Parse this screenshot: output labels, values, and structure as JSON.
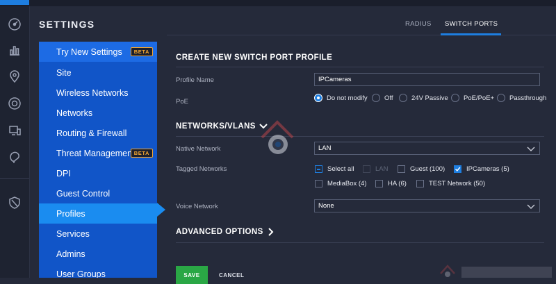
{
  "settings_title": "SETTINGS",
  "rail_icons": [
    "dashboard-icon",
    "statistics-icon",
    "map-icon",
    "devices-icon",
    "clients-icon",
    "insights-icon",
    "alerts-icon"
  ],
  "sidebar": {
    "items": [
      {
        "label": "Try New Settings",
        "badge": "BETA"
      },
      {
        "label": "Site"
      },
      {
        "label": "Wireless Networks"
      },
      {
        "label": "Networks"
      },
      {
        "label": "Routing & Firewall"
      },
      {
        "label": "Threat Management",
        "badge": "BETA"
      },
      {
        "label": "DPI"
      },
      {
        "label": "Guest Control"
      },
      {
        "label": "Profiles",
        "active": true
      },
      {
        "label": "Services"
      },
      {
        "label": "Admins"
      },
      {
        "label": "User Groups"
      }
    ]
  },
  "tabs": [
    {
      "label": "RADIUS"
    },
    {
      "label": "SWITCH PORTS",
      "active": true
    }
  ],
  "form": {
    "heading": "CREATE NEW SWITCH PORT PROFILE",
    "profile_name_label": "Profile Name",
    "profile_name_value": "IPCameras",
    "poe_label": "PoE",
    "poe_options": [
      "Do not modify",
      "Off",
      "24V Passive",
      "PoE/PoE+",
      "Passthrough"
    ],
    "poe_selected": "Do not modify",
    "networks_heading": "NETWORKS/VLANS",
    "native_network_label": "Native Network",
    "native_network_value": "LAN",
    "tagged_networks_label": "Tagged Networks",
    "tagged_networks": [
      {
        "label": "Select all",
        "state": "partial"
      },
      {
        "label": "LAN",
        "state": "disabled"
      },
      {
        "label": "Guest (100)",
        "state": "off"
      },
      {
        "label": "IPCameras (5)",
        "state": "on"
      },
      {
        "label": "MediaBox (4)",
        "state": "off"
      },
      {
        "label": "HA (6)",
        "state": "off"
      },
      {
        "label": "TEST Network (50)",
        "state": "off"
      }
    ],
    "voice_network_label": "Voice Network",
    "voice_network_value": "None",
    "advanced_heading": "ADVANCED OPTIONS",
    "save_label": "SAVE",
    "cancel_label": "CANCEL"
  },
  "colors": {
    "accent": "#1e7ee0",
    "sidebar": "#1155c8",
    "sidebar_active": "#1a8cf0",
    "background": "#252a3a",
    "save": "#2aa745",
    "beta_badge": "#f2a531"
  }
}
